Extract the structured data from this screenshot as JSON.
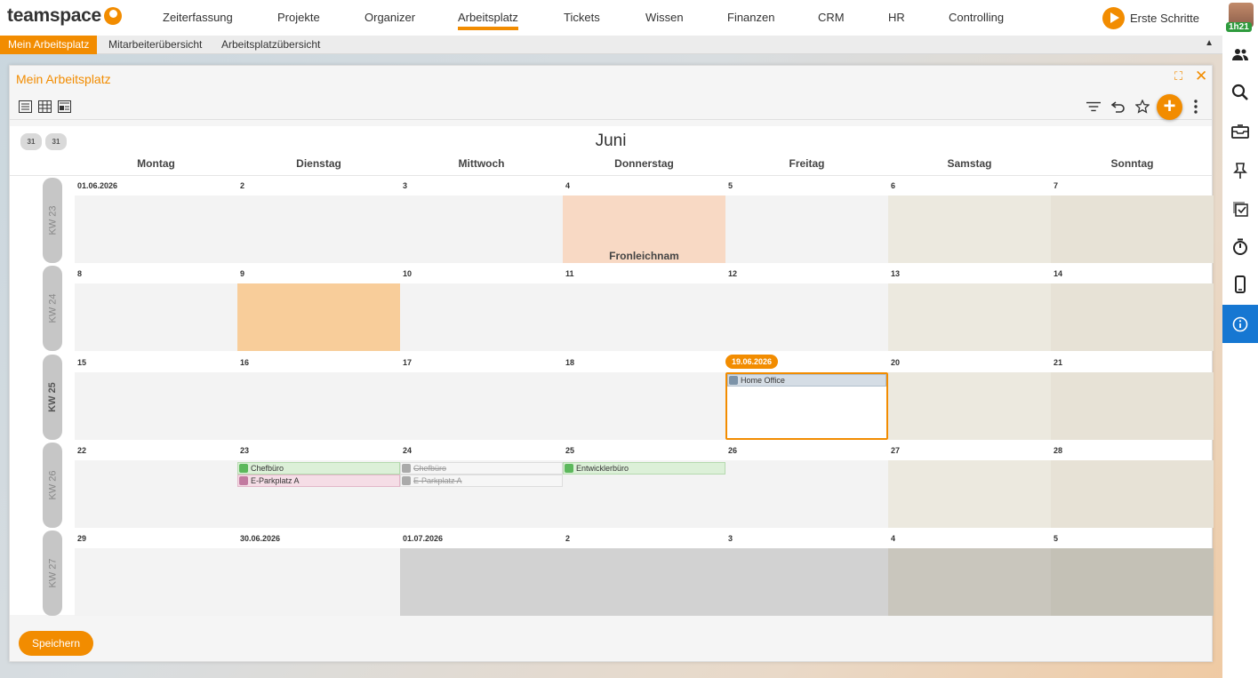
{
  "app": {
    "logo": "teamspace",
    "start_label": "Erste Schritte",
    "timer": "1h21"
  },
  "nav": [
    "Zeiterfassung",
    "Projekte",
    "Organizer",
    "Arbeitsplatz",
    "Tickets",
    "Wissen",
    "Finanzen",
    "CRM",
    "HR",
    "Controlling"
  ],
  "nav_active": "Arbeitsplatz",
  "subtabs": [
    "Mein Arbeitsplatz",
    "Mitarbeiterübersicht",
    "Arbeitsplatzübersicht"
  ],
  "sidebar_icons": [
    "users-icon",
    "search-icon",
    "inbox-icon",
    "pin-icon",
    "checklist-icon",
    "stopwatch-icon",
    "mobile-icon",
    "info-icon"
  ],
  "panel": {
    "title": "Mein Arbeitsplatz",
    "save_label": "Speichern"
  },
  "calendar": {
    "month": "Juni",
    "day_names": [
      "Montag",
      "Dienstag",
      "Mittwoch",
      "Donnerstag",
      "Freitag",
      "Samstag",
      "Sonntag"
    ],
    "weeks": [
      {
        "kw": "KW 23",
        "days": [
          "01.06.2026",
          "2",
          "3",
          "4",
          "5",
          "6",
          "7"
        ]
      },
      {
        "kw": "KW 24",
        "days": [
          "8",
          "9",
          "10",
          "11",
          "12",
          "13",
          "14"
        ]
      },
      {
        "kw": "KW 25",
        "days": [
          "15",
          "16",
          "17",
          "18",
          "19.06.2026",
          "20",
          "21"
        ]
      },
      {
        "kw": "KW 26",
        "days": [
          "22",
          "23",
          "24",
          "25",
          "26",
          "27",
          "28"
        ]
      },
      {
        "kw": "KW 27",
        "days": [
          "29",
          "30.06.2026",
          "01.07.2026",
          "2",
          "3",
          "4",
          "5"
        ]
      }
    ],
    "holiday": "Fronleichnam",
    "today": "19.06.2026",
    "events": {
      "home_office": "Home Office",
      "chefbuero_23": "Chefbüro",
      "parkplatz_23": "E-Parkplatz A",
      "chefbuero_24": "Chefbüro",
      "parkplatz_24": "E-Parkplatz A",
      "entwickler_25": "Entwicklerbüro"
    },
    "event_colors": {
      "workplace": "#dcf0d8",
      "parking": "#f5dde6",
      "cancelled": "#f6f6f6",
      "home": "#d5dde5"
    }
  },
  "colors": {
    "accent": "#f28c00",
    "active_sidebar": "#1677d2"
  }
}
